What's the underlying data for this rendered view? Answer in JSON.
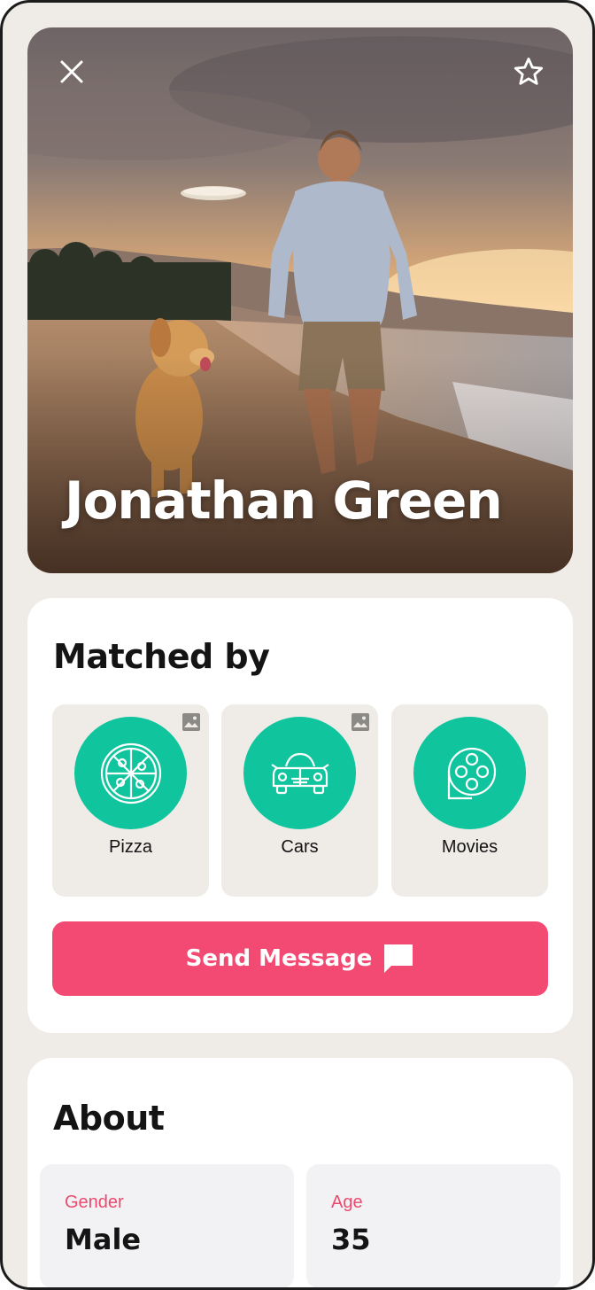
{
  "profile": {
    "name": "Jonathan Green",
    "photo_description": "Man walking on a beach at sunset with a golden retriever and a frisbee"
  },
  "hero_actions": {
    "close_icon": "close-icon",
    "favorite_icon": "star-outline-icon"
  },
  "matched": {
    "title": "Matched by",
    "items": [
      {
        "label": "Pizza",
        "icon": "pizza-icon",
        "has_photo_badge": true
      },
      {
        "label": "Cars",
        "icon": "car-icon",
        "has_photo_badge": true
      },
      {
        "label": "Movies",
        "icon": "film-reel-icon",
        "has_photo_badge": false
      }
    ],
    "send_button_label": "Send Message",
    "send_button_icon": "chat-bubble-icon"
  },
  "about": {
    "title": "About",
    "fields": [
      {
        "label": "Gender",
        "value": "Male"
      },
      {
        "label": "Age",
        "value": "35"
      }
    ]
  },
  "colors": {
    "accent_pink": "#f24a72",
    "accent_green": "#10c49d",
    "background": "#efece8"
  }
}
